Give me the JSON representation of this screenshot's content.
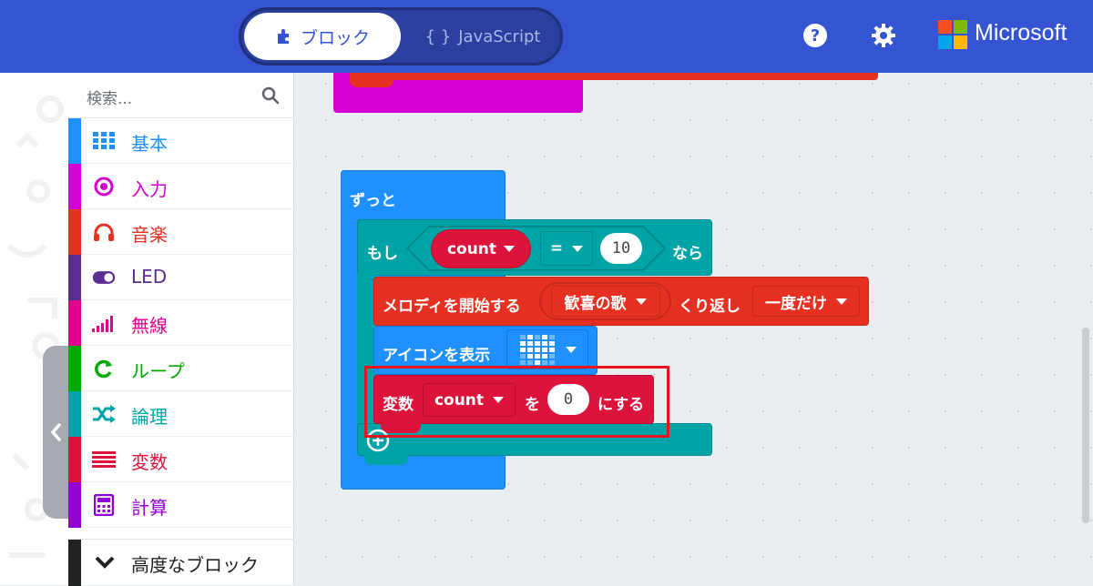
{
  "header": {
    "tab_blocks": "ブロック",
    "tab_javascript": "JavaScript",
    "brand": "Microsoft"
  },
  "toolbox": {
    "search_placeholder": "検索...",
    "categories": [
      {
        "label": "基本",
        "color": "#1e90ff"
      },
      {
        "label": "入力",
        "color": "#d400d4"
      },
      {
        "label": "音楽",
        "color": "#e63022"
      },
      {
        "label": "LED",
        "color": "#5c2d91"
      },
      {
        "label": "無線",
        "color": "#e3008c"
      },
      {
        "label": "ループ",
        "color": "#00aa00"
      },
      {
        "label": "論理",
        "color": "#00a4a6"
      },
      {
        "label": "変数",
        "color": "#dc143c"
      },
      {
        "label": "計算",
        "color": "#9400d3"
      }
    ],
    "advanced": "高度なブロック"
  },
  "blocks": {
    "forever_label": "ずっと",
    "if_label": "もし",
    "if_var": "count",
    "if_op": "=",
    "if_value": "10",
    "if_then": "なら",
    "melody_start": "メロディを開始する",
    "melody_name": "歓喜の歌",
    "melody_repeat": "くり返し",
    "melody_mode": "一度だけ",
    "show_icon": "アイコンを表示",
    "set_var_label": "変数",
    "set_var_name": "count",
    "set_var_wo": "を",
    "set_var_value": "0",
    "set_var_suffix": "にする"
  },
  "colors": {
    "header": "#3454d1",
    "loops": "#1e90ff",
    "logic": "#00a4a6",
    "music": "#e63022",
    "variables": "#dc143c",
    "basic": "#1e90ff",
    "highlight": "#e8141b"
  }
}
